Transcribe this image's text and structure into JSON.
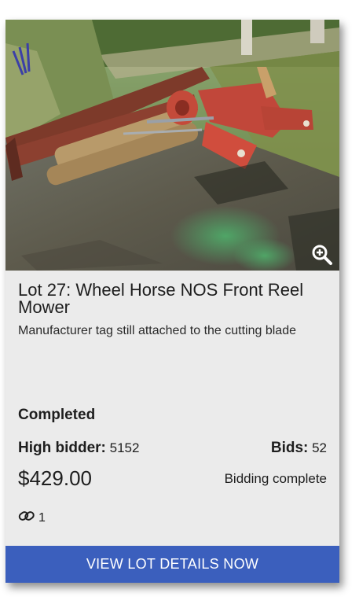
{
  "lot": {
    "title": "Lot 27: Wheel Horse NOS Front Reel Mower",
    "description": "Manufacturer tag still attached to the cutting blade",
    "status": "Completed",
    "high_bidder_label": "High bidder:",
    "high_bidder_value": "5152",
    "bids_label": "Bids:",
    "bids_value": "52",
    "price": "$429.00",
    "bidding_status": "Bidding complete",
    "link_count": "1"
  },
  "cta": {
    "label": "VIEW LOT DETAILS NOW"
  },
  "icons": {
    "zoom": "zoom-in-icon",
    "link": "link-icon"
  },
  "colors": {
    "card_background": "#ebebeb",
    "cta_background": "#3b5fbd",
    "cta_text": "#ffffff",
    "text": "#1e1e1e"
  }
}
